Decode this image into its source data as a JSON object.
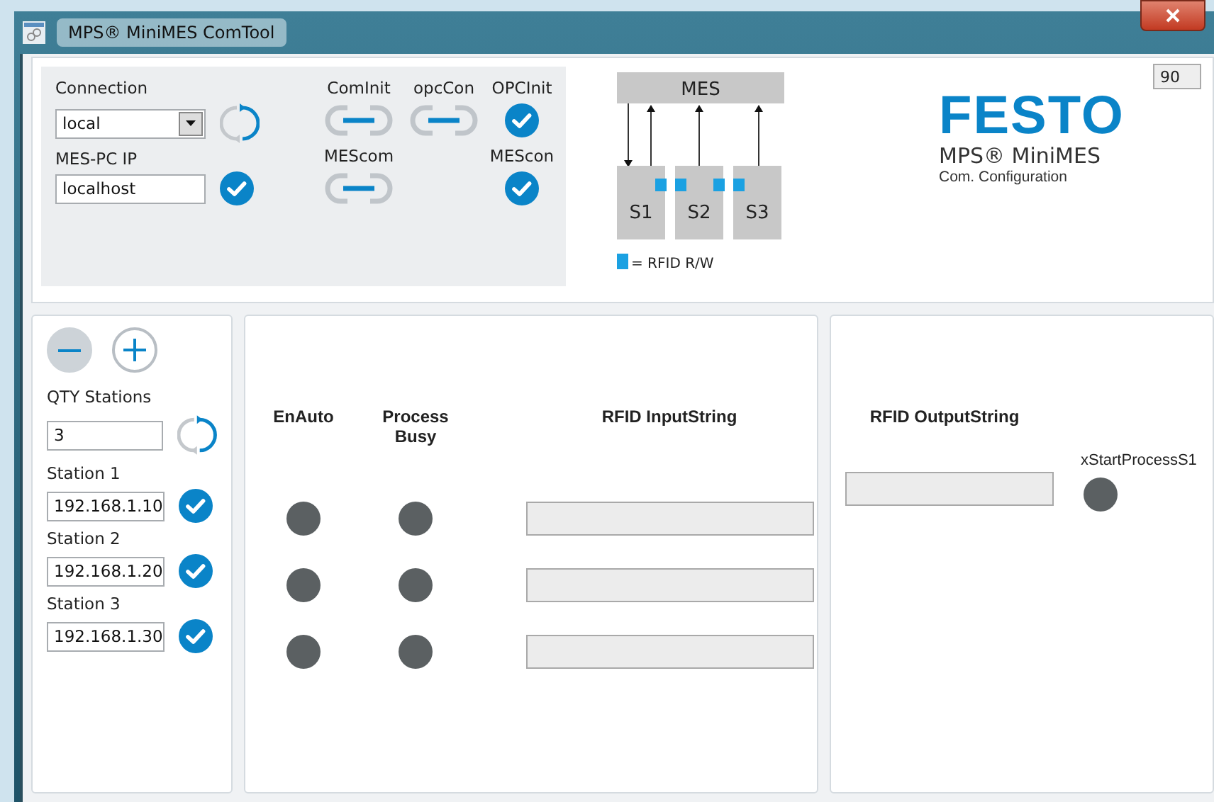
{
  "window": {
    "title": "MPS® MiniMES ComTool"
  },
  "connection": {
    "label": "Connection",
    "value": "local"
  },
  "mes_pc_ip": {
    "label": "MES-PC IP",
    "value": "localhost",
    "ok": true
  },
  "status": [
    {
      "label": "ComInit",
      "kind": "link"
    },
    {
      "label": "opcCon",
      "kind": "link"
    },
    {
      "label": "OPCInit",
      "kind": "check",
      "ok": true
    },
    {
      "label": "MEScom",
      "kind": "link"
    },
    {
      "label": "MEScon",
      "kind": "check",
      "ok": true
    }
  ],
  "diagram": {
    "top": "MES",
    "stations": [
      "S1",
      "S2",
      "S3"
    ],
    "legend": "= RFID R/W"
  },
  "counter": "90",
  "logo": {
    "brand": "FESTO",
    "product": "MPS® MiniMES",
    "subtitle": "Com. Configuration"
  },
  "qty": {
    "label": "QTY Stations",
    "value": "3"
  },
  "stations": [
    {
      "label": "Station 1",
      "value": "192.168.1.10",
      "ok": true
    },
    {
      "label": "Station 2",
      "value": "192.168.1.20",
      "ok": true
    },
    {
      "label": "Station 3",
      "value": "192.168.1.30",
      "ok": true
    }
  ],
  "io": {
    "columns": [
      "EnAuto",
      "Process Busy",
      "RFID InputString"
    ],
    "rows": [
      {
        "en_auto": false,
        "process_busy": false
      },
      {
        "en_auto": false,
        "process_busy": false
      },
      {
        "en_auto": false,
        "process_busy": false
      }
    ]
  },
  "output": {
    "header": "RFID OutputString",
    "led_label": "xStartProcessS1",
    "on": false
  }
}
